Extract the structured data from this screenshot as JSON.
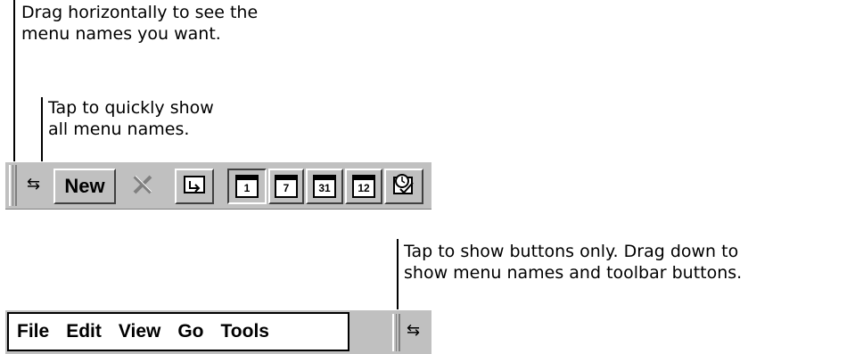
{
  "callouts": {
    "drag": {
      "line1": "Drag horizontally to see the",
      "line2": "menu names you want."
    },
    "tap_show": {
      "line1": "Tap to quickly show",
      "line2": "all menu names."
    },
    "tap_buttons": {
      "line1": "Tap to show buttons only. Drag down to",
      "line2": "show menu names and toolbar buttons."
    }
  },
  "toolbar": {
    "new_label": "New",
    "swap_glyph": "⇆",
    "calendar_buttons": [
      "1",
      "7",
      "31",
      "12"
    ],
    "icons": [
      "delete-icon",
      "folder-icon",
      "calendar-day-icon",
      "calendar-week-icon",
      "calendar-month-icon",
      "calendar-year-icon",
      "appointment-icon"
    ]
  },
  "menubar": {
    "items": [
      "File",
      "Edit",
      "View",
      "Go",
      "Tools"
    ],
    "swap_glyph": "⇆"
  }
}
